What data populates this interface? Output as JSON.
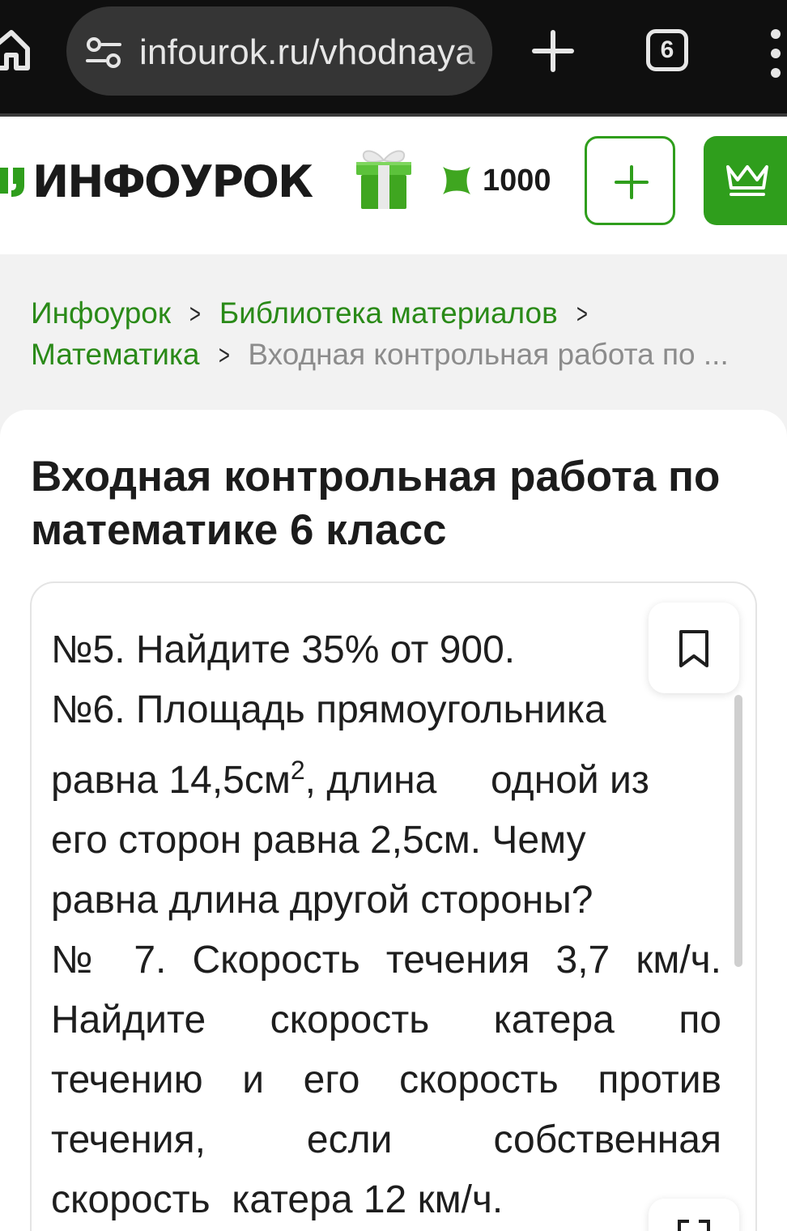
{
  "browser": {
    "url": "infourok.ru/vhodnaya",
    "tab_count": "6"
  },
  "header": {
    "logo_text": "ИНФОУРОК",
    "coins": "1000",
    "accent_color": "#2f9e1c"
  },
  "breadcrumb": {
    "items": [
      "Инфоурок",
      "Библиотека материалов",
      "Математика"
    ],
    "current": "Входная контрольная работа по ..."
  },
  "page": {
    "title": "Входная контрольная работа по математике 6 класс"
  },
  "document": {
    "task5": "№5. Найдите 35% от 900.",
    "task6_line1": "№6. Площадь прямоугольника",
    "task6_line2_a": "равна 14,5см",
    "task6_line2_sup": "2",
    "task6_line2_b": ", длина     одной из",
    "task6_line3": "его сторон равна 2,5см. Чему",
    "task6_line4": "равна длина другой стороны?",
    "task7_line1": "№ 7.  Скорость  течения  3,7  км/ч.",
    "task7_line2": "Найдите  скорость  катера  по",
    "task7_line3": "течению  и  его  скорость  против",
    "task7_line4": "течения,  если  собственная",
    "task7_line5": "скорость  катера 12 км/ч."
  },
  "icons": {
    "home": "home-icon",
    "site_settings": "tune-icon",
    "new_tab": "plus-icon",
    "gift": "gift-icon",
    "coin": "coin-icon",
    "add": "plus-icon",
    "premium": "crown-icon",
    "bookmark": "bookmark-icon",
    "expand": "expand-icon"
  }
}
